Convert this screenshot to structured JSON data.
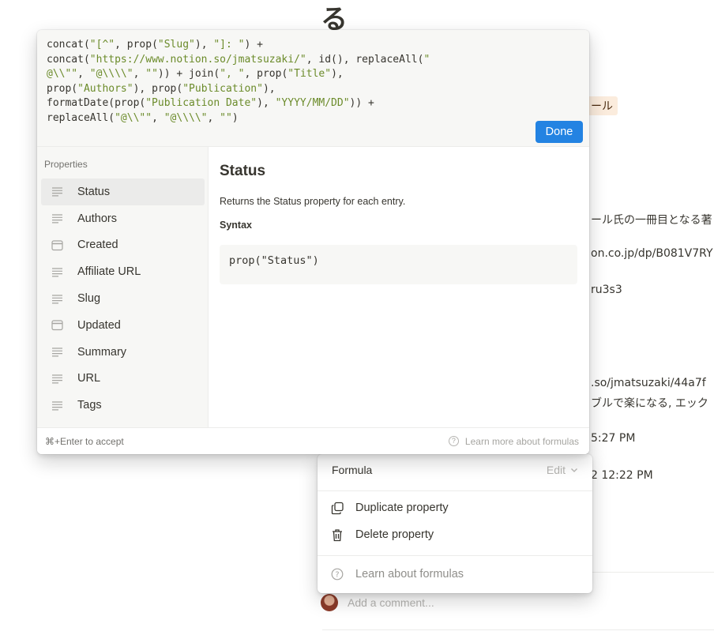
{
  "background": {
    "heading_char": "る",
    "tag_text": "ール",
    "lines": [
      "ール氏の一冊目となる著",
      "on.co.jp/dp/B081V7RY",
      "ru3s3",
      ".so/jmatsuzaki/44a7f",
      "ブルで楽になる, エック",
      "5:27 PM",
      "2 12:22 PM"
    ],
    "comment_placeholder": "Add a comment..."
  },
  "editor": {
    "code_lines": [
      [
        {
          "t": "concat(",
          "s": false
        },
        {
          "t": "\"[^\"",
          "s": true
        },
        {
          "t": ", prop(",
          "s": false
        },
        {
          "t": "\"Slug\"",
          "s": true
        },
        {
          "t": "), ",
          "s": false
        },
        {
          "t": "\"]: \"",
          "s": true
        },
        {
          "t": ") +",
          "s": false
        }
      ],
      [
        {
          "t": "concat(",
          "s": false
        },
        {
          "t": "\"https://www.notion.so/jmatsuzaki/\"",
          "s": true
        },
        {
          "t": ", id(), replaceAll(",
          "s": false
        },
        {
          "t": "\"",
          "s": true
        }
      ],
      [
        {
          "t": "@\\\\\"\"",
          "s": true
        },
        {
          "t": ", ",
          "s": false
        },
        {
          "t": "\"@\\\\\\\\\"",
          "s": true
        },
        {
          "t": ", ",
          "s": false
        },
        {
          "t": "\"\"",
          "s": true
        },
        {
          "t": ")) + join(",
          "s": false
        },
        {
          "t": "\", \"",
          "s": true
        },
        {
          "t": ", prop(",
          "s": false
        },
        {
          "t": "\"Title\"",
          "s": true
        },
        {
          "t": "),",
          "s": false
        }
      ],
      [
        {
          "t": "prop(",
          "s": false
        },
        {
          "t": "\"Authors\"",
          "s": true
        },
        {
          "t": "), prop(",
          "s": false
        },
        {
          "t": "\"Publication\"",
          "s": true
        },
        {
          "t": "),",
          "s": false
        }
      ],
      [
        {
          "t": "formatDate(prop(",
          "s": false
        },
        {
          "t": "\"Publication Date\"",
          "s": true
        },
        {
          "t": "), ",
          "s": false
        },
        {
          "t": "\"YYYY/MM/DD\"",
          "s": true
        },
        {
          "t": ")) +",
          "s": false
        }
      ],
      [
        {
          "t": "replaceAll(",
          "s": false
        },
        {
          "t": "\"@\\\\\"\"",
          "s": true
        },
        {
          "t": ", ",
          "s": false
        },
        {
          "t": "\"@\\\\\\\\\"",
          "s": true
        },
        {
          "t": ", ",
          "s": false
        },
        {
          "t": "\"\"",
          "s": true
        },
        {
          "t": ")",
          "s": false
        }
      ]
    ],
    "done_label": "Done",
    "sidebar_title": "Properties",
    "properties": [
      {
        "label": "Status",
        "icon": "text-icon",
        "active": true
      },
      {
        "label": "Authors",
        "icon": "text-icon",
        "active": false
      },
      {
        "label": "Created",
        "icon": "date-icon",
        "active": false
      },
      {
        "label": "Affiliate URL",
        "icon": "text-icon",
        "active": false
      },
      {
        "label": "Slug",
        "icon": "text-icon",
        "active": false
      },
      {
        "label": "Updated",
        "icon": "date-icon",
        "active": false
      },
      {
        "label": "Summary",
        "icon": "text-icon",
        "active": false
      },
      {
        "label": "URL",
        "icon": "text-icon",
        "active": false
      },
      {
        "label": "Tags",
        "icon": "text-icon",
        "active": false
      }
    ],
    "detail": {
      "title": "Status",
      "description": "Returns the Status property for each entry.",
      "syntax_label": "Syntax",
      "syntax_code": "prop(\"Status\")"
    },
    "footer_hint": "⌘+Enter to accept",
    "footer_learn": "Learn more about formulas"
  },
  "property_menu": {
    "type_label": "Formula",
    "edit_label": "Edit",
    "duplicate_label": "Duplicate property",
    "delete_label": "Delete property",
    "learn_label": "Learn about formulas"
  },
  "colors": {
    "accent": "#2383e2",
    "code_string": "#6b8b2a",
    "sidebar_bg": "#f7f7f5",
    "tag_bg": "#fbecdd"
  }
}
